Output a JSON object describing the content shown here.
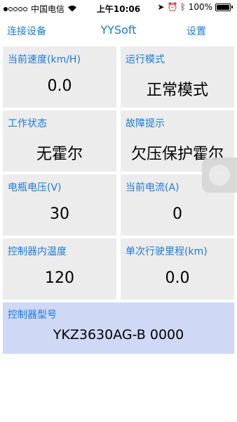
{
  "status_bar": {
    "carrier": "中国电信",
    "time": "上午10:06",
    "battery": "100%",
    "signal_bars": 1
  },
  "nav": {
    "left_button": "连接设备",
    "title": "YYSoft",
    "right_button": "设置"
  },
  "cells": [
    {
      "label": "当前速度(km/H)",
      "value": "0.0"
    },
    {
      "label": "运行模式",
      "value": "正常模式"
    },
    {
      "label": "工作状态",
      "value": "无霍尔"
    },
    {
      "label": "故障提示",
      "value": "欠压保护霍尔"
    },
    {
      "label": "电瓶电压(V)",
      "value": "30"
    },
    {
      "label": "当前电流(A)",
      "value": "0"
    },
    {
      "label": "控制器内温度",
      "value": "120"
    },
    {
      "label": "单次行驶里程(km)",
      "value": "0.0"
    }
  ],
  "model": {
    "label": "控制器型号",
    "value": "YKZ3630AG-B  0000"
  },
  "colors": {
    "accent": "#1a7ad9",
    "cell_bg": "#ececec",
    "model_bg": "#cfd8f5"
  }
}
